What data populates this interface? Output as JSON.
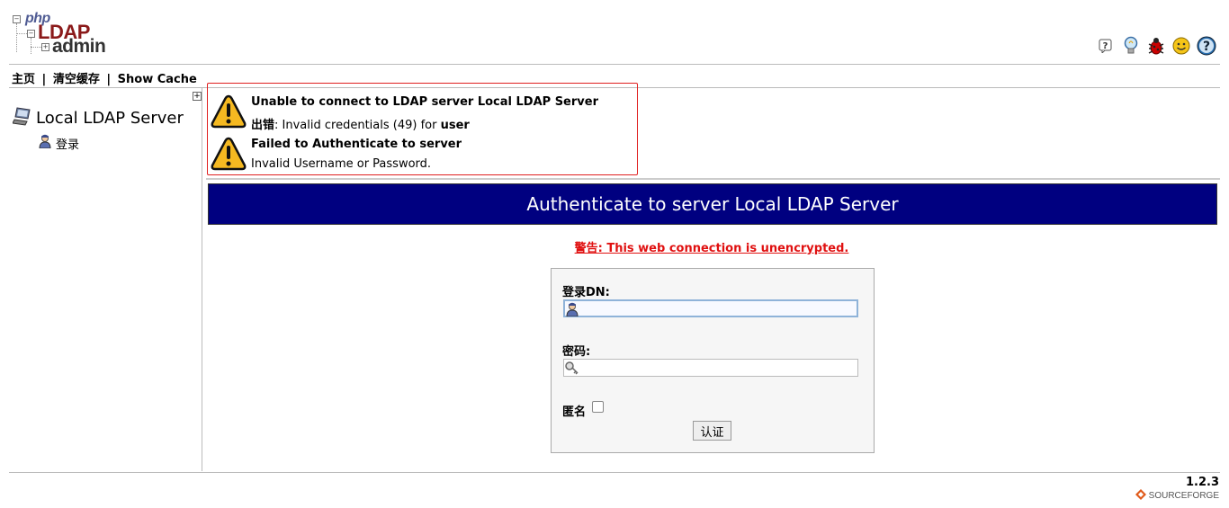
{
  "header": {
    "logo": {
      "php": "php",
      "ldap": "LDAP",
      "admin": "admin"
    },
    "icons": [
      "help-icon",
      "lightbulb-icon",
      "bug-icon",
      "smiley-icon",
      "question-icon"
    ]
  },
  "nav": {
    "home": "主页",
    "purge_cache": "清空缓存",
    "show_cache": "Show Cache",
    "separator": "|"
  },
  "sidebar": {
    "expand": "+",
    "server_name": "Local LDAP Server",
    "login_label": "登录"
  },
  "errors": [
    {
      "title": "Unable to connect to LDAP server Local LDAP Server",
      "body_prefix": "出错",
      "body_text": ": Invalid credentials (49) for ",
      "body_bold": "user"
    },
    {
      "title": "Failed to Authenticate to server",
      "body_text": "Invalid Username or Password."
    }
  ],
  "main": {
    "title": "Authenticate to server Local LDAP Server",
    "warning": "警告: This web connection is unencrypted."
  },
  "form": {
    "dn_label": "登录DN:",
    "dn_value": "",
    "password_label": "密码:",
    "password_value": "",
    "anonymous_label": "匿名",
    "anonymous_checked": false,
    "submit_label": "认证"
  },
  "footer": {
    "version": "1.2.3",
    "sourceforge": "SOURCEFORGE"
  },
  "colors": {
    "title_bar": "#000080",
    "warning_text": "#e01010",
    "error_border": "#e02020"
  }
}
